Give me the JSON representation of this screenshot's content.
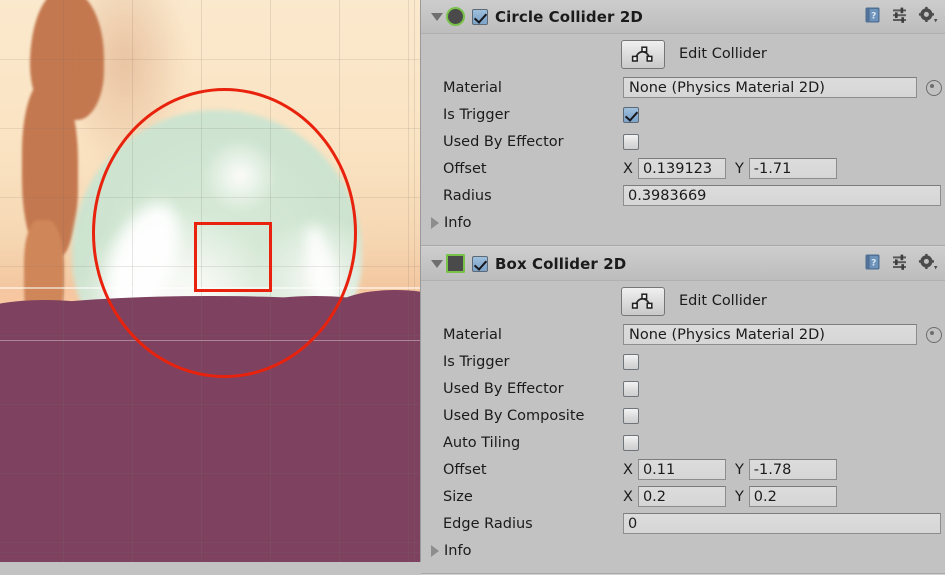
{
  "scene_view": {
    "name": "scene-game-view",
    "description": "2D scene with bubble sprite and collider gizmos",
    "colors": {
      "sky": "#fae3c2",
      "ground": "#7e4260",
      "bubble": "#cde5d2",
      "trunk": "#c4784f",
      "gizmo": "#e8220c"
    },
    "gizmos": [
      {
        "name": "circle-collider-gizmo",
        "shape": "circle"
      },
      {
        "name": "box-collider-gizmo",
        "shape": "rectangle"
      }
    ]
  },
  "inspector": {
    "components": [
      {
        "id": "circle-collider-2d",
        "title": "Circle Collider 2D",
        "icon": "circle-collider-icon",
        "enabled": true,
        "expanded": true,
        "edit_collider_label": "Edit Collider",
        "rows": [
          {
            "label": "Material",
            "type": "object",
            "value": "None (Physics Material 2D)"
          },
          {
            "label": "Is Trigger",
            "type": "bool",
            "value": true
          },
          {
            "label": "Used By Effector",
            "type": "bool",
            "value": false
          },
          {
            "label": "Offset",
            "type": "vector2",
            "x": "0.139123",
            "y": "-1.71"
          },
          {
            "label": "Radius",
            "type": "float",
            "value": "0.3983669"
          }
        ],
        "info_label": "Info"
      },
      {
        "id": "box-collider-2d",
        "title": "Box Collider 2D",
        "icon": "box-collider-icon",
        "enabled": true,
        "expanded": true,
        "edit_collider_label": "Edit Collider",
        "rows": [
          {
            "label": "Material",
            "type": "object",
            "value": "None (Physics Material 2D)"
          },
          {
            "label": "Is Trigger",
            "type": "bool",
            "value": false
          },
          {
            "label": "Used By Effector",
            "type": "bool",
            "value": false
          },
          {
            "label": "Used By Composite",
            "type": "bool",
            "value": false
          },
          {
            "label": "Auto Tiling",
            "type": "bool",
            "value": false
          },
          {
            "label": "Offset",
            "type": "vector2",
            "x": "0.11",
            "y": "-1.78"
          },
          {
            "label": "Size",
            "type": "vector2",
            "x": "0.2",
            "y": "0.2"
          },
          {
            "label": "Edge Radius",
            "type": "float",
            "value": "0"
          }
        ],
        "info_label": "Info"
      }
    ],
    "axis_labels": {
      "x": "X",
      "y": "Y"
    },
    "header_icons": [
      {
        "name": "help-icon",
        "glyph": "?"
      },
      {
        "name": "preset-icon",
        "glyph": ""
      },
      {
        "name": "context-menu-icon",
        "glyph": ""
      }
    ],
    "colors": {
      "panel_bg": "#c2c2c2",
      "header_bg": "#c7c7c7",
      "field_bg": "#d8d8d8",
      "component_accent": "#79c24a",
      "checkbox_checked": "#89add0"
    }
  }
}
